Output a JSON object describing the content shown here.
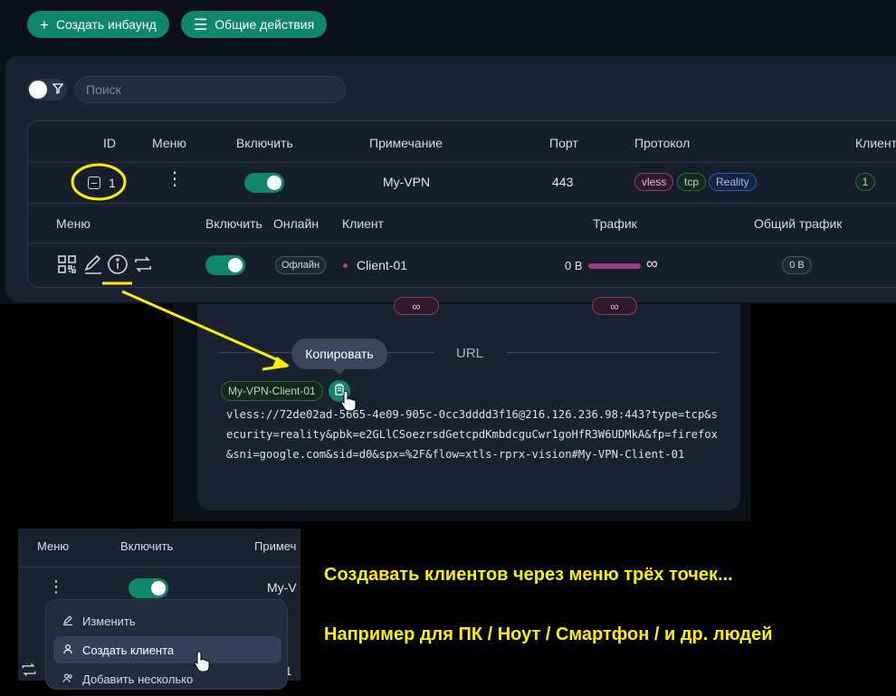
{
  "toolbar": {
    "create_inbound": "Создать инбаунд",
    "general_actions": "Общие действия"
  },
  "search": {
    "placeholder": "Поиск"
  },
  "inbounds_table": {
    "headers": [
      "ID",
      "Меню",
      "Включить",
      "Примечание",
      "Порт",
      "Протокол",
      "Клиент"
    ],
    "row": {
      "id": "1",
      "enabled": true,
      "remark": "My-VPN",
      "port": "443",
      "protocol_tags": [
        "vless",
        "tcp",
        "Reality"
      ],
      "clients_count": "1"
    }
  },
  "clients_table": {
    "headers": [
      "Меню",
      "Включить",
      "Онлайн",
      "Клиент",
      "Трафик",
      "Общий трафик"
    ],
    "row": {
      "enabled": true,
      "online_status": "Офлайн",
      "client": "Client-01",
      "traffic_used": "0 B",
      "traffic_limit": "∞",
      "total_traffic": "0 B"
    }
  },
  "url_panel": {
    "infinity_values": [
      "∞",
      "∞"
    ],
    "tooltip": "Копировать",
    "title": "URL",
    "client_tag": "My-VPN-Client-01",
    "url": "vless://72de02ad-5665-4e09-905c-0cc3dddd3f16@216.126.236.98:443?type=tcp&security=reality&pbk=e2GLlCSoezrsdGetcpdKmbdcguCwr1goHfR3W6UDMkA&fp=firefox&sni=google.com&sid=d0&spx=%2F&flow=xtls-rprx-vision#My-VPN-Client-01"
  },
  "menu_snippet": {
    "headers": [
      "Меню",
      "Включить",
      "Примеч"
    ],
    "remark_partial": "My-V",
    "partial_id": "1",
    "items": [
      "Изменить",
      "Создать клиента",
      "Добавить несколько"
    ]
  },
  "captions": {
    "line1": "Создавать клиентов через меню трёх точек...",
    "line2": "Например для ПК / Ноут / Смартфон / и др. людей"
  },
  "colors": {
    "accent": "#10876a",
    "annotation": "#ffee00",
    "panel": "#1a2232"
  }
}
